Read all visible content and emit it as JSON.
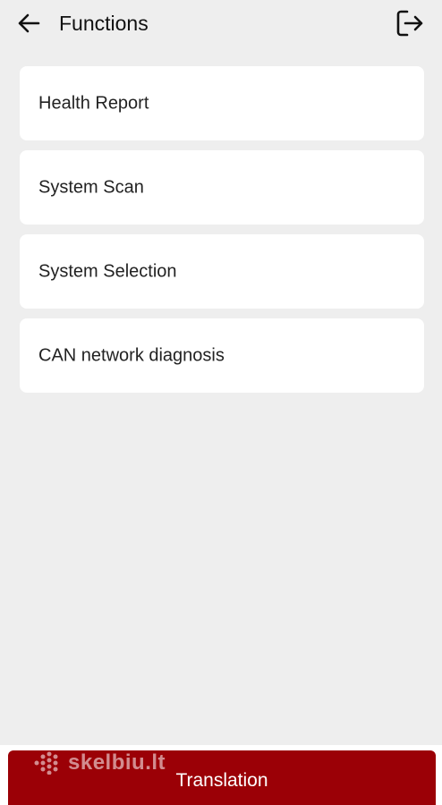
{
  "header": {
    "title": "Functions",
    "back_icon": "arrow-left-icon",
    "exit_icon": "logout-icon"
  },
  "functions": [
    {
      "label": "Health Report"
    },
    {
      "label": "System Scan"
    },
    {
      "label": "System Selection"
    },
    {
      "label": "CAN network diagnosis"
    }
  ],
  "bottom": {
    "translation_label": "Translation",
    "button_color": "#9b0006"
  },
  "watermark": {
    "text": "skelbiu.lt"
  }
}
